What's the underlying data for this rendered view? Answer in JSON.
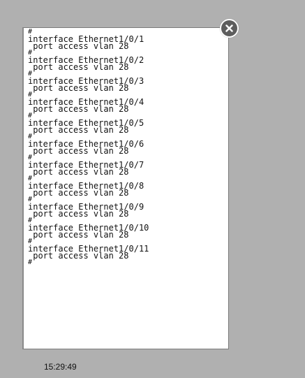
{
  "config": {
    "lines": [
      "#",
      "interface Ethernet1/0/1",
      " port access vlan 28",
      "#",
      "interface Ethernet1/0/2",
      " port access vlan 28",
      "#",
      "interface Ethernet1/0/3",
      " port access vlan 28",
      "#",
      "interface Ethernet1/0/4",
      " port access vlan 28",
      "#",
      "interface Ethernet1/0/5",
      " port access vlan 28",
      "#",
      "interface Ethernet1/0/6",
      " port access vlan 28",
      "#",
      "interface Ethernet1/0/7",
      " port access vlan 28",
      "#",
      "interface Ethernet1/0/8",
      " port access vlan 28",
      "#",
      "interface Ethernet1/0/9",
      " port access vlan 28",
      "#",
      "interface Ethernet1/0/10",
      " port access vlan 28",
      "#",
      "interface Ethernet1/0/11",
      " port access vlan 28",
      "#"
    ]
  },
  "close_button": {
    "icon": "close-icon"
  },
  "footer": {
    "timestamp": "15:29:49"
  },
  "colors": {
    "background": "#b0b0b0",
    "panel": "#ffffff",
    "close_button": "#5d5d5d"
  }
}
